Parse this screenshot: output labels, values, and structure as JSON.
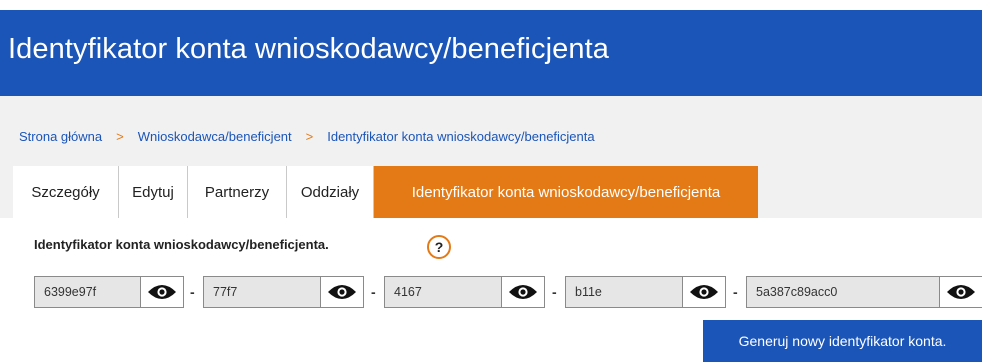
{
  "header": {
    "title": "Identyfikator konta wnioskodawcy/beneficjenta"
  },
  "breadcrumb": {
    "items": [
      "Strona główna",
      "Wnioskodawca/beneficjent",
      "Identyfikator konta wnioskodawcy/beneficjenta"
    ],
    "separator": ">"
  },
  "tabs": [
    {
      "label": "Szczegóły"
    },
    {
      "label": "Edytuj"
    },
    {
      "label": "Partnerzy"
    },
    {
      "label": "Oddziały"
    },
    {
      "label": "Identyfikator konta wnioskodawcy/beneficjenta"
    }
  ],
  "form": {
    "label": "Identyfikator konta wnioskodawcy/beneficjenta.",
    "help": "?",
    "segments": [
      "6399e97f",
      "77f7",
      "4167",
      "b11e",
      "5a387c89acc0"
    ],
    "separator": "-",
    "generate_label": "Generuj nowy identyfikator konta."
  },
  "icons": {
    "help": "question-icon",
    "reveal": "eye-icon"
  },
  "colors": {
    "primary": "#1b55b8",
    "accent": "#e47a16",
    "background": "#f1f1f1"
  }
}
